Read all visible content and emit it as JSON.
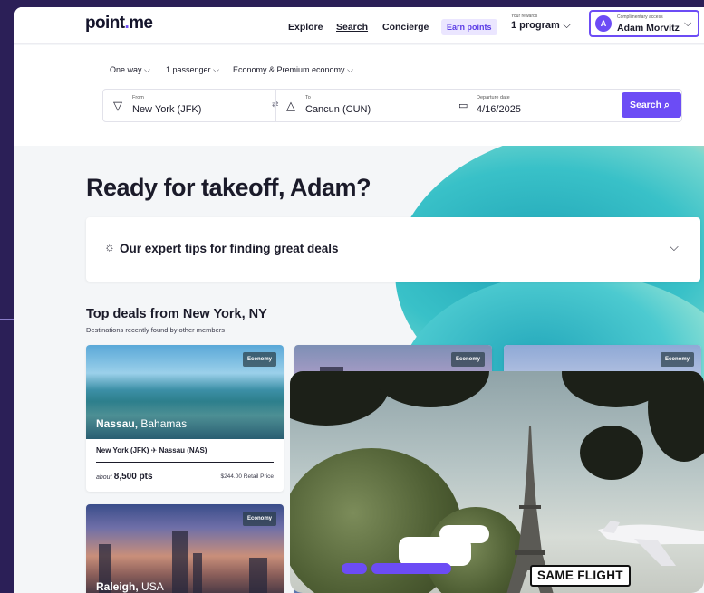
{
  "header": {
    "logo": "pointme",
    "logo_parts": [
      "point",
      ".",
      "me"
    ],
    "nav": [
      "Explore",
      "Search",
      "Concierge"
    ],
    "earn_points": "Earn points",
    "rewards_label": "Your rewards",
    "rewards_value": "1 program",
    "user_label": "Complimentary access",
    "user_name": "Adam Morvitz",
    "avatar_initial": "A"
  },
  "filters": {
    "trip_type": "One way",
    "passengers": "1 passenger",
    "cabin": "Economy & Premium economy"
  },
  "search": {
    "from_label": "From",
    "from_value": "New York (JFK)",
    "to_label": "To",
    "to_value": "Cancun (CUN)",
    "date_label": "Departure date",
    "date_value": "4/16/2025",
    "button": "Search"
  },
  "hero": {
    "title": "Ready for takeoff, Adam?",
    "tips": "Our expert tips for finding great deals",
    "deals_title": "Top deals from New York, NY",
    "deals_subtitle": "Destinations recently found by other members"
  },
  "cards": [
    {
      "badge": "Economy",
      "city": "Nassau,",
      "country": "Bahamas",
      "route_from": "New York (JFK)",
      "route_to": "Nassau (NAS)",
      "pts_prefix": "about",
      "pts": "8,500 pts",
      "retail": "$244.00 Retail Price"
    },
    {
      "badge": "Economy"
    },
    {
      "badge": "Economy"
    },
    {
      "badge": "Economy",
      "city": "Raleigh,",
      "country": "USA"
    }
  ],
  "overlay": {
    "caption": "SAME FLIGHT"
  },
  "colors": {
    "brand": "#6c4cf5",
    "background": "#2b1f57"
  },
  "icons": [
    "chevron-down-icon",
    "plane-departure-icon",
    "plane-arrival-icon",
    "calendar-icon",
    "search-icon",
    "lightbulb-icon",
    "swap-icon",
    "plane-icon"
  ]
}
